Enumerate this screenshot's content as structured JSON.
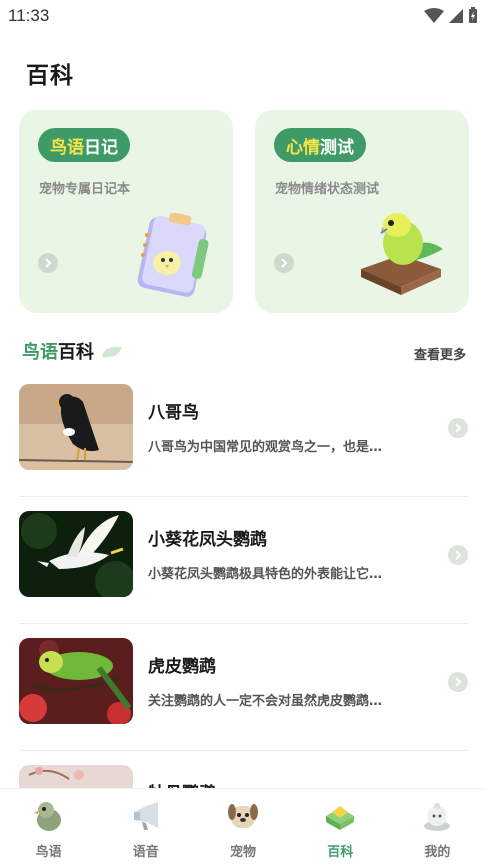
{
  "status": {
    "time": "11:33"
  },
  "page": {
    "title": "百科"
  },
  "cards": [
    {
      "pill_a": "鸟语",
      "pill_b": "日记",
      "subtitle": "宠物专属日记本",
      "icon": "notebook-bird-icon"
    },
    {
      "pill_a": "心情",
      "pill_b": "测试",
      "subtitle": "宠物情绪状态测试",
      "icon": "parrot-book-icon"
    }
  ],
  "section": {
    "title_a": "鸟语",
    "title_b": "百科",
    "view_more": "查看更多"
  },
  "items": [
    {
      "title": "八哥鸟",
      "desc": "八哥鸟为中国常见的观赏鸟之一，也是…"
    },
    {
      "title": "小葵花凤头鹦鹉",
      "desc": "小葵花凤头鹦鹉极具特色的外表能让它…"
    },
    {
      "title": "虎皮鹦鹉",
      "desc": "关注鹦鹉的人一定不会对虽然虎皮鹦鹉…"
    },
    {
      "title": "牡丹鹦鹉",
      "desc": ""
    }
  ],
  "tabs": [
    {
      "label": "鸟语",
      "icon": "bird-icon",
      "active": false
    },
    {
      "label": "语音",
      "icon": "megaphone-icon",
      "active": false
    },
    {
      "label": "宠物",
      "icon": "dog-icon",
      "active": false
    },
    {
      "label": "百科",
      "icon": "encyclopedia-icon",
      "active": true
    },
    {
      "label": "我的",
      "icon": "profile-icon",
      "active": false
    }
  ],
  "colors": {
    "accent": "#3e9a66",
    "card_bg": "#e9f6e6",
    "pill_highlight": "#f7e34c"
  }
}
